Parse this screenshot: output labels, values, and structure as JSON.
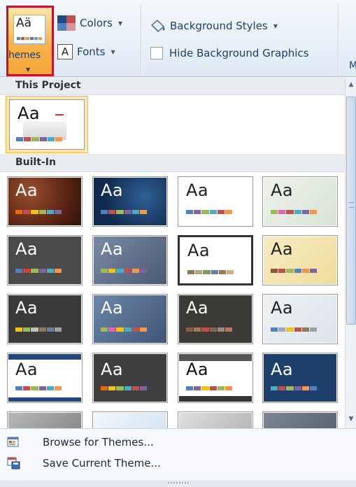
{
  "ribbon": {
    "themes_label": "hemes",
    "colors_label": "Colors",
    "fonts_label": "Fonts",
    "fonts_glyph": "A",
    "background_styles_label": "Background Styles",
    "hide_bg_label": "Hide Background Graphics",
    "hide_bg_checked": false,
    "cutoff_label": "M",
    "themes_thumb_text": "Aä"
  },
  "gallery": {
    "this_project_header": "This Project",
    "builtin_header": "Built-In",
    "thumb_text": "Aa"
  },
  "menu": {
    "browse_label": "Browse for Themes...",
    "save_label": "Save Current Theme..."
  },
  "colors": {
    "selected_highlight": "#fde7a8",
    "themes_button_border": "#c0152f",
    "ribbon_text": "#1e3f6b"
  }
}
